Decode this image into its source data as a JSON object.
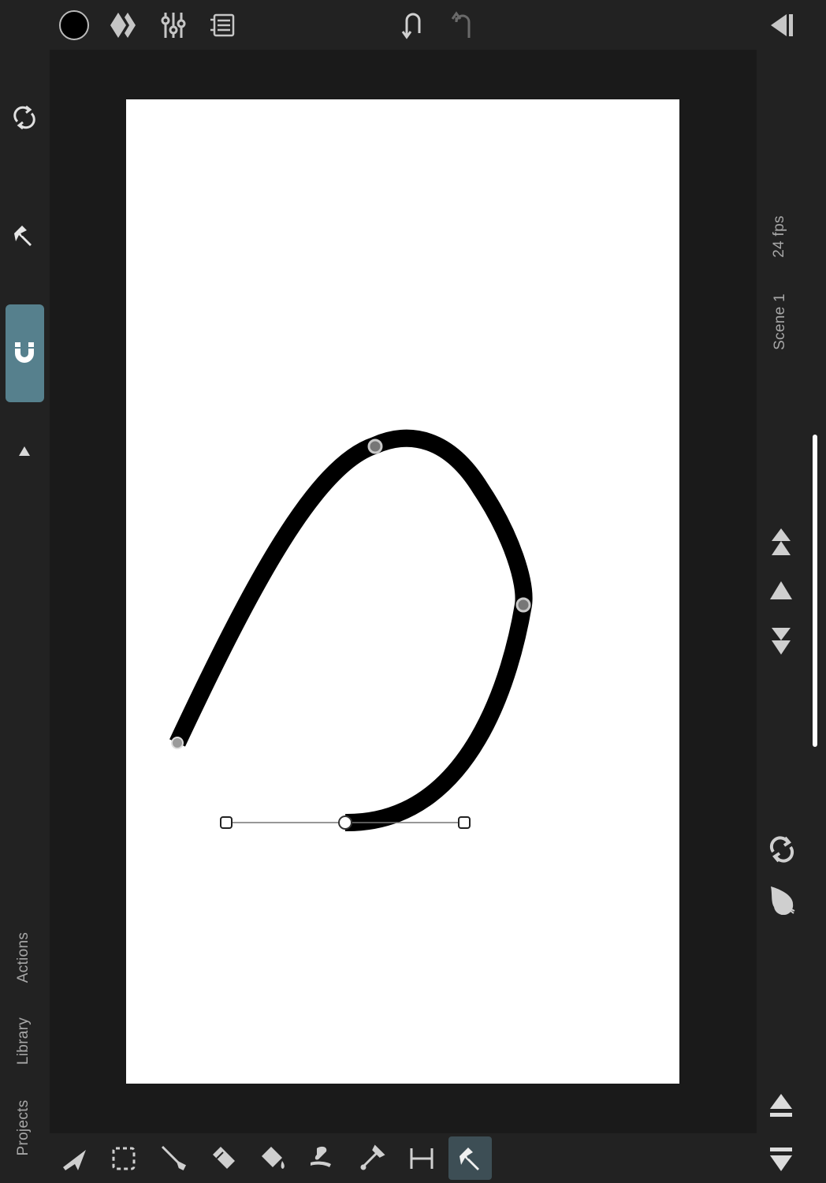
{
  "top_toolbar": {
    "color_swatch": "#000000",
    "icons": [
      "color-swatch-icon",
      "keyframe-diamond-icon",
      "sliders-icon",
      "layers-stack-icon",
      "undo-icon",
      "redo-icon",
      "collapse-panel-icon"
    ]
  },
  "left_sidebar": {
    "icons": [
      "refresh-icon",
      "pen-nib-icon",
      "magnet-icon",
      "triangle-up-icon"
    ],
    "magnet_active_color": "#56808d",
    "labels": {
      "actions": "Actions",
      "library": "Library",
      "projects": "Projects"
    }
  },
  "right_sidebar": {
    "fps": "24 fps",
    "scene": "Scene 1",
    "icons": [
      "move-to-top-icon",
      "move-up-icon",
      "move-to-bottom-icon",
      "loop-icon",
      "onion-skin-icon",
      "eject-up-icon",
      "eject-down-icon"
    ]
  },
  "bottom_toolbar": {
    "tools": [
      "select-arrow-icon",
      "marquee-select-icon",
      "brush-icon",
      "eraser-icon",
      "fill-bucket-icon",
      "smudge-icon",
      "eyedropper-icon",
      "ruler-icon",
      "pen-tool-icon"
    ],
    "active_tool": "pen-tool-icon",
    "active_color": "#3d4e55"
  },
  "canvas": {
    "background": "#ffffff",
    "stroke_color": "#000000"
  }
}
